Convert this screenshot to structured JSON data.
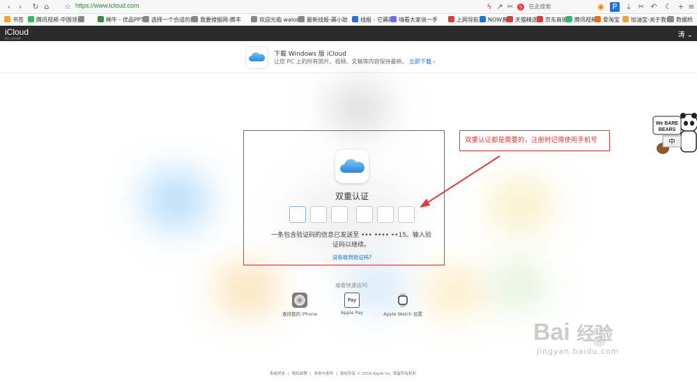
{
  "browser": {
    "url": "https://www.icloud.com",
    "search_placeholder": "在此搜索"
  },
  "bookmarks": [
    {
      "label": "书签",
      "color": "#f5a623"
    },
    {
      "label": "腾讯视频-中国领先",
      "color": "#2dbb6a"
    },
    {
      "label": "",
      "color": "#888888"
    },
    {
      "label": "稀牛 - 优品PPT",
      "color": "#3b8e3b"
    },
    {
      "label": "选择一个合适的抖",
      "color": "#888888"
    },
    {
      "label": "我要搜报网-腾丰",
      "color": "#888888"
    },
    {
      "label": "欢迎光临 walo纸",
      "color": "#888888"
    },
    {
      "label": "最新线报-薅小助",
      "color": "#888888"
    },
    {
      "label": "线报 - 它薅网",
      "color": "#1a73e8"
    },
    {
      "label": "嗨看大家说一手",
      "color": "#6c6cff"
    },
    {
      "label": "上网导航",
      "color": "#e53935"
    },
    {
      "label": "NOW直播",
      "color": "#1a73e8"
    },
    {
      "label": "天猫精选",
      "color": "#e53935"
    },
    {
      "label": "京东商城",
      "color": "#e53935"
    },
    {
      "label": "腾讯视频",
      "color": "#2dbb6a"
    },
    {
      "label": "爱淘宝",
      "color": "#ff6a00"
    },
    {
      "label": "加油宝-关于我们",
      "color": "#f5a623"
    },
    {
      "label": "数据桥",
      "color": "#888888"
    }
  ],
  "header": {
    "brand": "iCloud",
    "brand_sub": "由云上贵州运营",
    "user": "涛 ⌄"
  },
  "banner": {
    "title": "下载 Windows 版 iCloud",
    "text": "让您 PC 上的所有照片、视频、文稿等内容保持最新。",
    "link": "立即下载 ›"
  },
  "dialog": {
    "title": "双重认证",
    "message": "一条包含验证码的信息已发送至 ••• •••• ••15。输入验证码以继续。",
    "resend": "没有收到验证码?"
  },
  "annotation": {
    "text": "双重认证都是需要的，注册时记得使用手机号",
    "color": "#e53935"
  },
  "quick": {
    "label": "或者快速访问:",
    "items": [
      {
        "label": "查找我的 iPhone",
        "icon": "find-iphone-icon"
      },
      {
        "label": "Apple Pay",
        "icon": "apple-pay-icon"
      },
      {
        "label": "Apple Watch 设置",
        "icon": "apple-watch-icon"
      }
    ]
  },
  "footer": {
    "items": [
      "系统状态",
      "隐私政策",
      "条款与条件",
      "版权所有 © 2019 Apple Inc. 保留所有权利"
    ]
  },
  "watermark": {
    "word": "Bai",
    "suffix": "经验",
    "url": "jingyan.baidu.com"
  },
  "sticker": {
    "title": "We BARE BEARS",
    "mark": "中"
  },
  "colors": {
    "accent": "#0a70c9",
    "header_bg": "#2a2a2a",
    "annotation": "#e53935"
  }
}
